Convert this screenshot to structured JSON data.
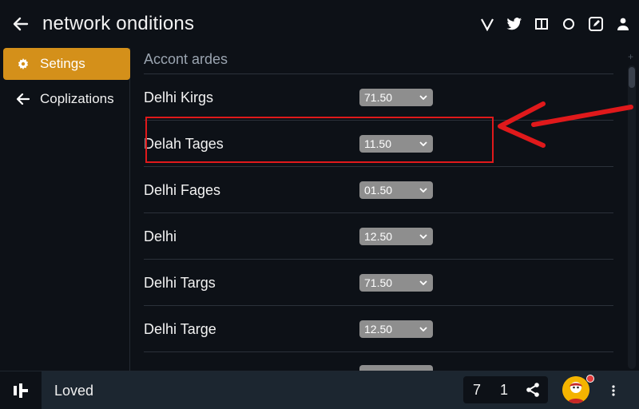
{
  "header": {
    "title": "network onditions",
    "back_icon": "arrow-left-icon",
    "icons": [
      "v-icon",
      "twitter-icon",
      "windows-icon",
      "circle-icon",
      "edit-square-icon",
      "people-icon"
    ]
  },
  "sidebar": {
    "items": [
      {
        "label": "Setings",
        "icon": "gear-icon",
        "active": true
      },
      {
        "label": "Coplizations",
        "icon": "arrow-left-icon",
        "active": false
      }
    ]
  },
  "main": {
    "section_title": "Accont ardes",
    "rows": [
      {
        "label": "Delhi Kirgs",
        "value": "71.50"
      },
      {
        "label": "Delah Tages",
        "value": "11.50"
      },
      {
        "label": "Delhi Fages",
        "value": "01.50"
      },
      {
        "label": "Delhi",
        "value": "12.50"
      },
      {
        "label": "Delhi Targs",
        "value": "71.50"
      },
      {
        "label": "Delhi Targe",
        "value": "12.50"
      }
    ]
  },
  "bottom": {
    "status": "Loved",
    "counts": [
      "7",
      "1"
    ],
    "share_icon": "share-icon",
    "avatar_icon": "avatar",
    "menu_icon": "kebab-menu-icon"
  },
  "colors": {
    "accent": "#d4901a",
    "highlight": "#e0191b",
    "background": "#0d1117"
  }
}
